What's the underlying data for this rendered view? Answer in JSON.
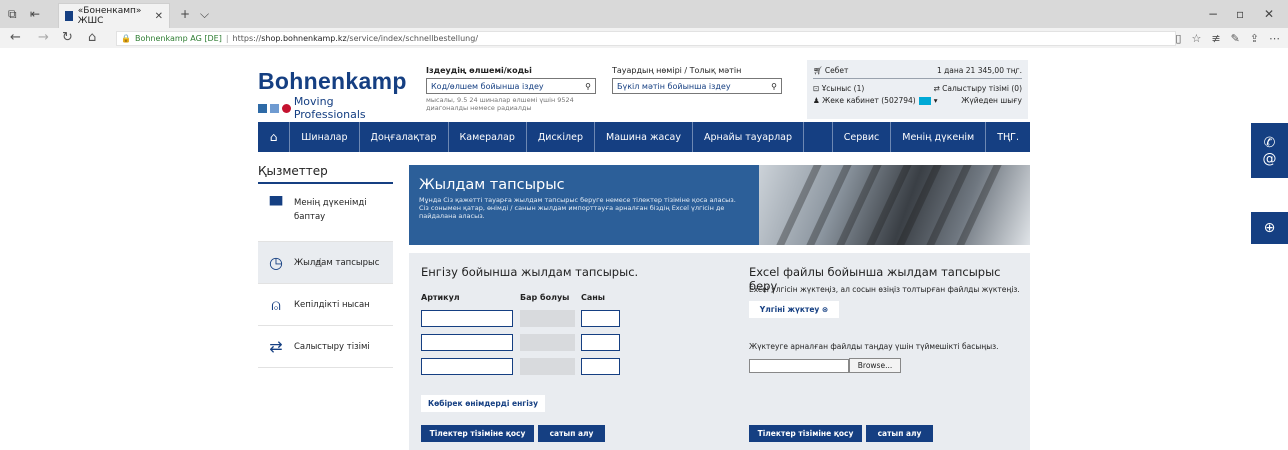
{
  "browser": {
    "tab_title": "«Боненкамп» ЖШС",
    "tab_close": "✕",
    "new_tab": "+",
    "tab_menu": "⌵",
    "site_identity": "Bohnenkamp AG [DE]",
    "url_prefix": "https://",
    "url_host": "shop.bohnenkamp.kz",
    "url_path": "/service/index/schnellbestellung/",
    "window_min": "−",
    "window_max": "▫",
    "window_close": "✕"
  },
  "logo": {
    "name": "Bohnenkamp",
    "tagline": "Moving Professionals",
    "colors": [
      "#2e6aa6",
      "#6f9bd1",
      "#c4122f"
    ]
  },
  "search": {
    "code_label": "Іздеудің өлшемі/кодьі",
    "code_placeholder": "Код/өлшем бойынша іздеу",
    "code_hint": "мысалы, 9.5 24 шиналар өлшемі үшін 9524 диагоналды немесе радиалды",
    "text_label": "Тауардың нөмірі / Толық мәтін",
    "text_placeholder": "Бүкіл мәтін бойынша іздеу"
  },
  "account": {
    "cart_label": "Себет",
    "cart_summary": "1 дана  21 345,00 тңг.",
    "offers_label": "Ұсыныс (1)",
    "compare_label": "Салыстыру тізімі (0)",
    "cabinet_label": "Жеке кабинет (502794)",
    "logout_label": "Жүйеден шығу"
  },
  "nav": {
    "items": [
      "Шиналар",
      "Доңғалақтар",
      "Камералар",
      "Дискілер",
      "Машина жасау",
      "Арнайы тауарлар",
      "Сервис",
      "Менің дүкенім",
      "ТҢГ."
    ]
  },
  "sidebar": {
    "title": "Қызметтер",
    "items": [
      "Менің дүкенімді баптау",
      "Жылдам тапсырыс",
      "Кепілдікті нысан",
      "Салыстыру тізімі"
    ]
  },
  "banner": {
    "title": "Жылдам тапсырыс",
    "description": "Мұнда Сіз қажетті тауарға жылдам тапсырыс беруге немесе тілектер тізіміне қоса аласыз. Сіз сонымен қатар, өнімді / санын жылдам импорттауға арналған біздің Excel үлгісін де пайдалана аласыз."
  },
  "order_form": {
    "title": "Енгізу бойынша жылдам тапсырыс.",
    "col_article": "Артикул",
    "col_availability": "Бар болуы",
    "col_quantity": "Саны",
    "more_button": "Көбірек өнімдерді енгізу",
    "wishlist_button": "Тілектер тізіміне қосу",
    "buy_button": "сатып алу"
  },
  "excel_form": {
    "title": "Excel файлы бойынша жылдам тапсырыс беру",
    "instruction": "Excel үлгісін жүктеңіз, ал сосын өзіңіз толтырған файлды жүктеңіз.",
    "template_button": "Үлгіні жүктеу ⊛",
    "file_instruction": "Жүктеуге арналған файлды таңдау үшін түймешікті басыңыз.",
    "browse_button": "Browse...",
    "wishlist_button": "Тілектер тізіміне қосу",
    "buy_button": "сатып алу"
  }
}
